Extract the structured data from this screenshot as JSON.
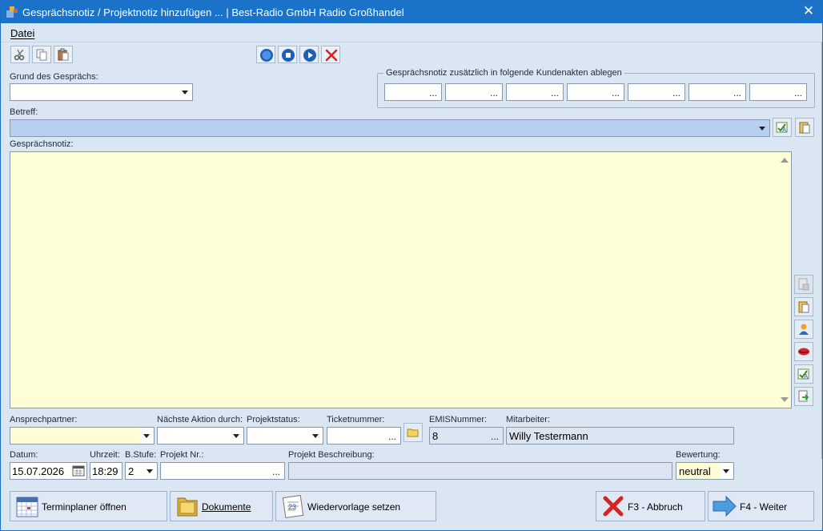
{
  "window": {
    "title": "Gesprächsnotiz / Projektnotiz hinzufügen ... | Best-Radio GmbH Radio Großhandel",
    "close_glyph": "✕"
  },
  "menu": {
    "items": [
      "Datei"
    ]
  },
  "toolbar": {
    "icons": [
      "scissors-icon",
      "copy-icon",
      "paste-icon",
      "record-icon",
      "stop-icon",
      "play-icon",
      "cancel-icon"
    ]
  },
  "form": {
    "grund_label": "Grund des Gesprächs:",
    "grund_value": "",
    "kundenakten_legend": "Gesprächsnotiz zusätzlich in folgende Kundenakten ablegen",
    "kundenakten_fields": [
      "",
      "",
      "",
      "",
      "",
      "",
      ""
    ],
    "dots": "...",
    "betreff_label": "Betreff:",
    "betreff_value": "",
    "notiz_label": "Gesprächsnotiz:",
    "notiz_value": "",
    "ansprechpartner_label": "Ansprechpartner:",
    "ansprechpartner_value": "",
    "naechste_aktion_label": "Nächste Aktion durch:",
    "naechste_aktion_value": "",
    "projektstatus_label": "Projektstatus:",
    "projektstatus_value": "",
    "ticketnummer_label": "Ticketnummer:",
    "ticketnummer_value": "",
    "emis_label": "EMISNummer:",
    "emis_value": "8",
    "mitarbeiter_label": "Mitarbeiter:",
    "mitarbeiter_value": "Willy Testermann",
    "datum_label": "Datum:",
    "datum_value": "15.07.2026",
    "uhrzeit_label": "Uhrzeit:",
    "uhrzeit_value": "18:29",
    "bstufe_label": "B.Stufe:",
    "bstufe_value": "2",
    "projekt_nr_label": "Projekt Nr.:",
    "projekt_nr_value": "",
    "projekt_beschreibung_label": "Projekt Beschreibung:",
    "projekt_beschreibung_value": "",
    "bewertung_label": "Bewertung:",
    "bewertung_value": "neutral"
  },
  "buttons": {
    "terminplaner": "Terminplaner öffnen",
    "dokumente": "Dokumente",
    "wiedervorlage": "Wiedervorlage setzen",
    "abbruch": "F3 - Abbruch",
    "weiter": "F4 - Weiter"
  },
  "colors": {
    "titlebar": "#1a73c9",
    "window_bg": "#dbe6f3",
    "betreff_bg": "#b7cff0",
    "note_bg": "#fefed6",
    "highlight_field": "#fefed6"
  }
}
